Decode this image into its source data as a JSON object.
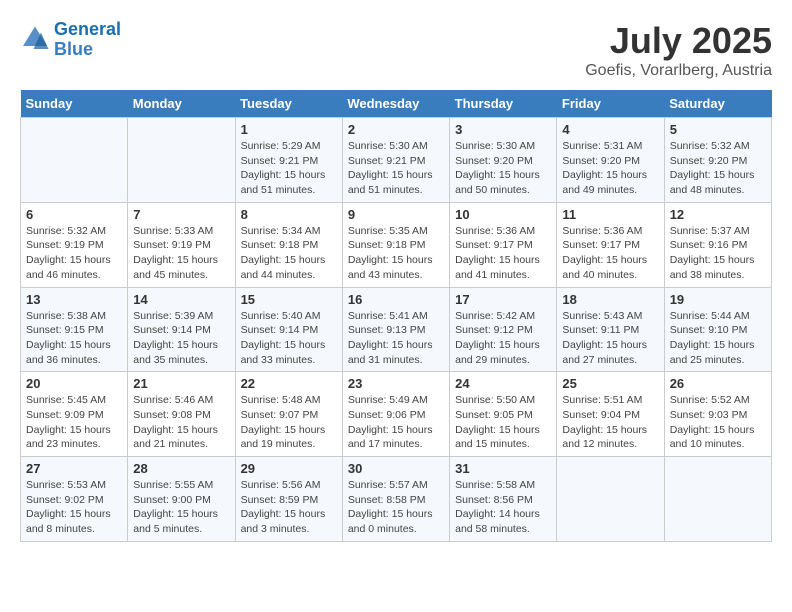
{
  "header": {
    "logo_line1": "General",
    "logo_line2": "Blue",
    "month_title": "July 2025",
    "location": "Goefis, Vorarlberg, Austria"
  },
  "days_of_week": [
    "Sunday",
    "Monday",
    "Tuesday",
    "Wednesday",
    "Thursday",
    "Friday",
    "Saturday"
  ],
  "weeks": [
    [
      {
        "day": "",
        "sunrise": "",
        "sunset": "",
        "daylight": ""
      },
      {
        "day": "",
        "sunrise": "",
        "sunset": "",
        "daylight": ""
      },
      {
        "day": "1",
        "sunrise": "Sunrise: 5:29 AM",
        "sunset": "Sunset: 9:21 PM",
        "daylight": "Daylight: 15 hours and 51 minutes."
      },
      {
        "day": "2",
        "sunrise": "Sunrise: 5:30 AM",
        "sunset": "Sunset: 9:21 PM",
        "daylight": "Daylight: 15 hours and 51 minutes."
      },
      {
        "day": "3",
        "sunrise": "Sunrise: 5:30 AM",
        "sunset": "Sunset: 9:20 PM",
        "daylight": "Daylight: 15 hours and 50 minutes."
      },
      {
        "day": "4",
        "sunrise": "Sunrise: 5:31 AM",
        "sunset": "Sunset: 9:20 PM",
        "daylight": "Daylight: 15 hours and 49 minutes."
      },
      {
        "day": "5",
        "sunrise": "Sunrise: 5:32 AM",
        "sunset": "Sunset: 9:20 PM",
        "daylight": "Daylight: 15 hours and 48 minutes."
      }
    ],
    [
      {
        "day": "6",
        "sunrise": "Sunrise: 5:32 AM",
        "sunset": "Sunset: 9:19 PM",
        "daylight": "Daylight: 15 hours and 46 minutes."
      },
      {
        "day": "7",
        "sunrise": "Sunrise: 5:33 AM",
        "sunset": "Sunset: 9:19 PM",
        "daylight": "Daylight: 15 hours and 45 minutes."
      },
      {
        "day": "8",
        "sunrise": "Sunrise: 5:34 AM",
        "sunset": "Sunset: 9:18 PM",
        "daylight": "Daylight: 15 hours and 44 minutes."
      },
      {
        "day": "9",
        "sunrise": "Sunrise: 5:35 AM",
        "sunset": "Sunset: 9:18 PM",
        "daylight": "Daylight: 15 hours and 43 minutes."
      },
      {
        "day": "10",
        "sunrise": "Sunrise: 5:36 AM",
        "sunset": "Sunset: 9:17 PM",
        "daylight": "Daylight: 15 hours and 41 minutes."
      },
      {
        "day": "11",
        "sunrise": "Sunrise: 5:36 AM",
        "sunset": "Sunset: 9:17 PM",
        "daylight": "Daylight: 15 hours and 40 minutes."
      },
      {
        "day": "12",
        "sunrise": "Sunrise: 5:37 AM",
        "sunset": "Sunset: 9:16 PM",
        "daylight": "Daylight: 15 hours and 38 minutes."
      }
    ],
    [
      {
        "day": "13",
        "sunrise": "Sunrise: 5:38 AM",
        "sunset": "Sunset: 9:15 PM",
        "daylight": "Daylight: 15 hours and 36 minutes."
      },
      {
        "day": "14",
        "sunrise": "Sunrise: 5:39 AM",
        "sunset": "Sunset: 9:14 PM",
        "daylight": "Daylight: 15 hours and 35 minutes."
      },
      {
        "day": "15",
        "sunrise": "Sunrise: 5:40 AM",
        "sunset": "Sunset: 9:14 PM",
        "daylight": "Daylight: 15 hours and 33 minutes."
      },
      {
        "day": "16",
        "sunrise": "Sunrise: 5:41 AM",
        "sunset": "Sunset: 9:13 PM",
        "daylight": "Daylight: 15 hours and 31 minutes."
      },
      {
        "day": "17",
        "sunrise": "Sunrise: 5:42 AM",
        "sunset": "Sunset: 9:12 PM",
        "daylight": "Daylight: 15 hours and 29 minutes."
      },
      {
        "day": "18",
        "sunrise": "Sunrise: 5:43 AM",
        "sunset": "Sunset: 9:11 PM",
        "daylight": "Daylight: 15 hours and 27 minutes."
      },
      {
        "day": "19",
        "sunrise": "Sunrise: 5:44 AM",
        "sunset": "Sunset: 9:10 PM",
        "daylight": "Daylight: 15 hours and 25 minutes."
      }
    ],
    [
      {
        "day": "20",
        "sunrise": "Sunrise: 5:45 AM",
        "sunset": "Sunset: 9:09 PM",
        "daylight": "Daylight: 15 hours and 23 minutes."
      },
      {
        "day": "21",
        "sunrise": "Sunrise: 5:46 AM",
        "sunset": "Sunset: 9:08 PM",
        "daylight": "Daylight: 15 hours and 21 minutes."
      },
      {
        "day": "22",
        "sunrise": "Sunrise: 5:48 AM",
        "sunset": "Sunset: 9:07 PM",
        "daylight": "Daylight: 15 hours and 19 minutes."
      },
      {
        "day": "23",
        "sunrise": "Sunrise: 5:49 AM",
        "sunset": "Sunset: 9:06 PM",
        "daylight": "Daylight: 15 hours and 17 minutes."
      },
      {
        "day": "24",
        "sunrise": "Sunrise: 5:50 AM",
        "sunset": "Sunset: 9:05 PM",
        "daylight": "Daylight: 15 hours and 15 minutes."
      },
      {
        "day": "25",
        "sunrise": "Sunrise: 5:51 AM",
        "sunset": "Sunset: 9:04 PM",
        "daylight": "Daylight: 15 hours and 12 minutes."
      },
      {
        "day": "26",
        "sunrise": "Sunrise: 5:52 AM",
        "sunset": "Sunset: 9:03 PM",
        "daylight": "Daylight: 15 hours and 10 minutes."
      }
    ],
    [
      {
        "day": "27",
        "sunrise": "Sunrise: 5:53 AM",
        "sunset": "Sunset: 9:02 PM",
        "daylight": "Daylight: 15 hours and 8 minutes."
      },
      {
        "day": "28",
        "sunrise": "Sunrise: 5:55 AM",
        "sunset": "Sunset: 9:00 PM",
        "daylight": "Daylight: 15 hours and 5 minutes."
      },
      {
        "day": "29",
        "sunrise": "Sunrise: 5:56 AM",
        "sunset": "Sunset: 8:59 PM",
        "daylight": "Daylight: 15 hours and 3 minutes."
      },
      {
        "day": "30",
        "sunrise": "Sunrise: 5:57 AM",
        "sunset": "Sunset: 8:58 PM",
        "daylight": "Daylight: 15 hours and 0 minutes."
      },
      {
        "day": "31",
        "sunrise": "Sunrise: 5:58 AM",
        "sunset": "Sunset: 8:56 PM",
        "daylight": "Daylight: 14 hours and 58 minutes."
      },
      {
        "day": "",
        "sunrise": "",
        "sunset": "",
        "daylight": ""
      },
      {
        "day": "",
        "sunrise": "",
        "sunset": "",
        "daylight": ""
      }
    ]
  ]
}
